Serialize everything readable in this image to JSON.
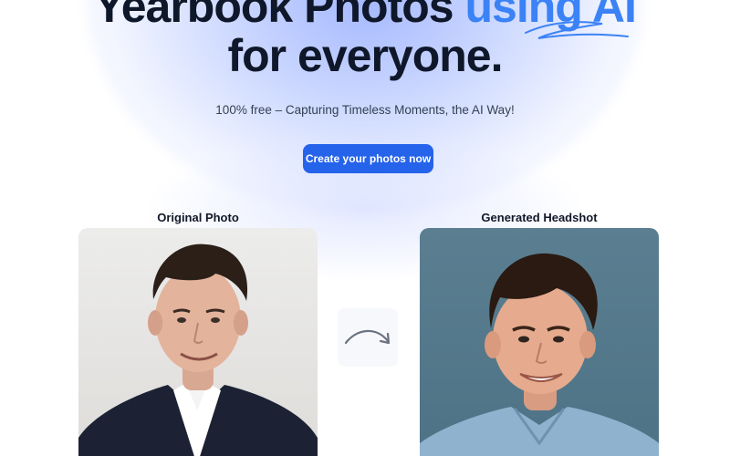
{
  "hero": {
    "title_part1": "Yearbook Photos",
    "title_accent": "using AI",
    "title_line2": "for everyone."
  },
  "subtitle": "100% free – Capturing Timeless Moments, the AI Way!",
  "cta_label": "Create your photos now",
  "comparison": {
    "original_caption": "Original Photo",
    "generated_caption": "Generated Headshot"
  },
  "colors": {
    "accent": "#3b82f6",
    "button": "#2563eb",
    "title": "#0f172a"
  },
  "icons": {
    "squiggle": "underline-squiggle-icon",
    "arrow": "curved-arrow-right-icon"
  }
}
